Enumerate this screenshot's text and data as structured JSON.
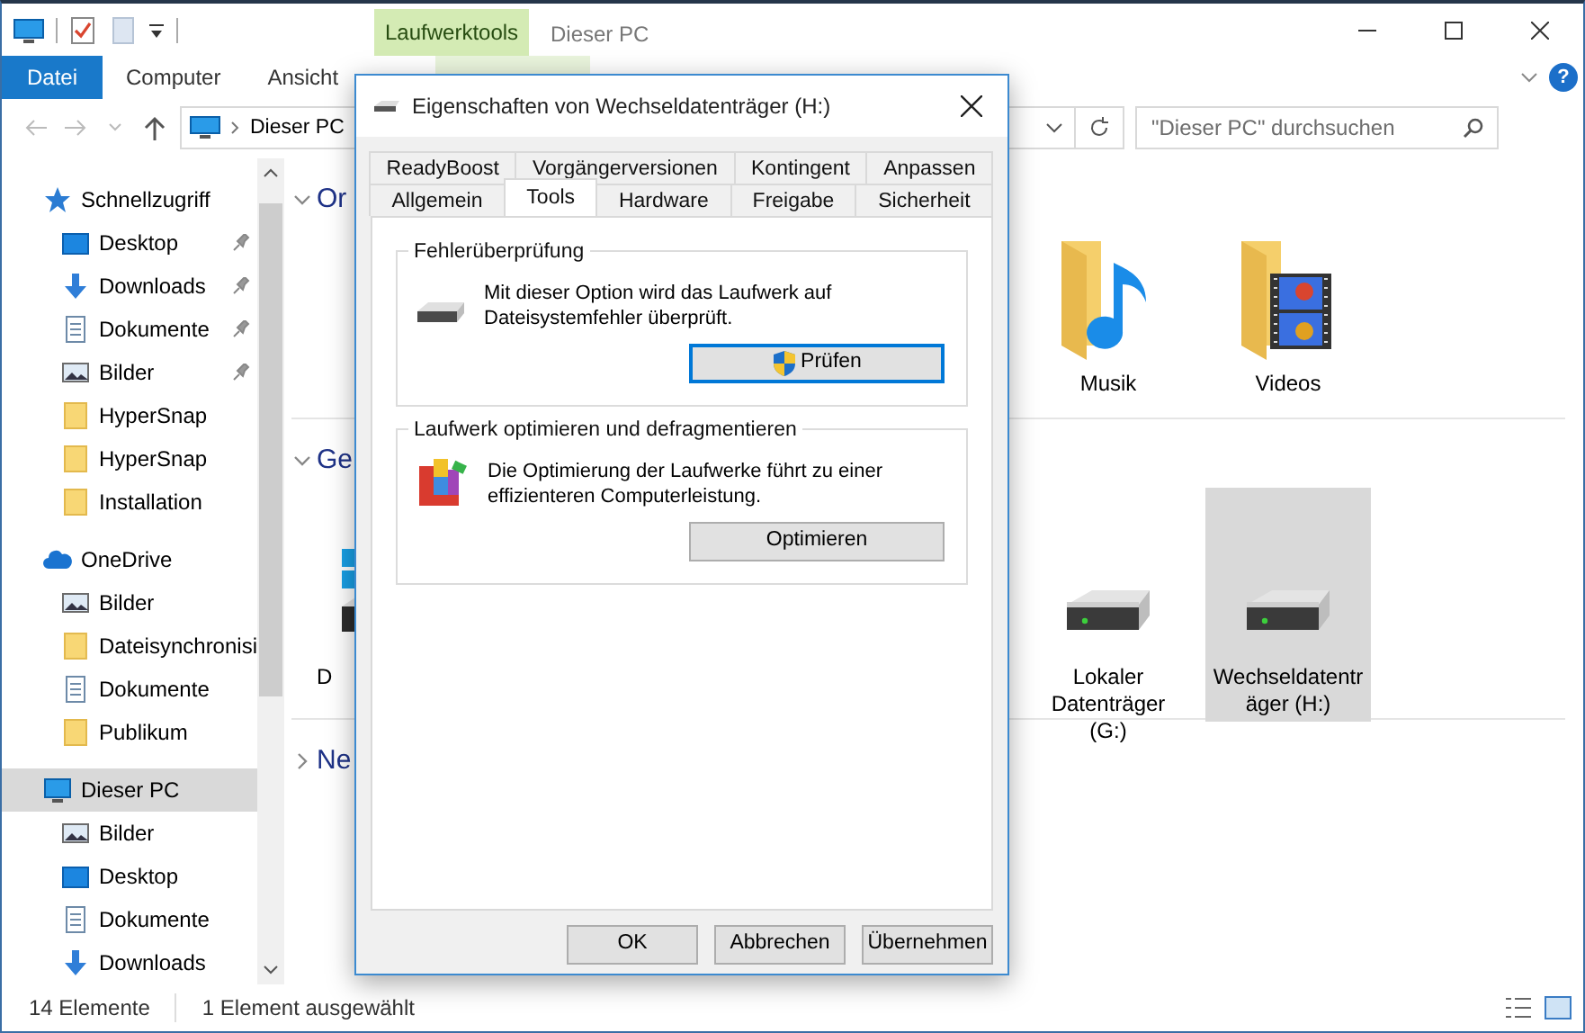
{
  "window": {
    "title": "Dieser PC",
    "context_tab": "Laufwerktools"
  },
  "ribbon_tabs": [
    {
      "label": "Datei",
      "kind": "file"
    },
    {
      "label": "Computer",
      "kind": "tab"
    },
    {
      "label": "Ansicht",
      "kind": "tab"
    }
  ],
  "address_bar": {
    "path": "Dieser PC"
  },
  "search": {
    "placeholder": "\"Dieser PC\" durchsuchen"
  },
  "help_button": {
    "label": "?"
  },
  "sidebar": {
    "items": [
      {
        "label": "Schnellzugriff",
        "kind": "star",
        "selected": false,
        "children": [
          {
            "label": "Desktop",
            "kind": "desktop",
            "pinned": true,
            "selected": false
          },
          {
            "label": "Downloads",
            "kind": "download",
            "pinned": true,
            "selected": false
          },
          {
            "label": "Dokumente",
            "kind": "document",
            "pinned": true,
            "selected": false
          },
          {
            "label": "Bilder",
            "kind": "picture",
            "pinned": true,
            "selected": false
          },
          {
            "label": "HyperSnap",
            "kind": "folder",
            "pinned": false,
            "selected": false
          },
          {
            "label": "HyperSnap",
            "kind": "folder",
            "pinned": false,
            "selected": false
          },
          {
            "label": "Installation",
            "kind": "folder",
            "pinned": false,
            "selected": false
          }
        ]
      },
      {
        "label": "OneDrive",
        "kind": "cloud",
        "selected": false,
        "children": [
          {
            "label": "Bilder",
            "kind": "picture",
            "selected": false
          },
          {
            "label": "Dateisynchronisi",
            "kind": "folder",
            "selected": false
          },
          {
            "label": "Dokumente",
            "kind": "document",
            "selected": false
          },
          {
            "label": "Publikum",
            "kind": "folder",
            "selected": false
          }
        ]
      },
      {
        "label": "Dieser PC",
        "kind": "computer",
        "selected": true,
        "children": [
          {
            "label": "Bilder",
            "kind": "picture",
            "selected": false
          },
          {
            "label": "Desktop",
            "kind": "desktop",
            "selected": false
          },
          {
            "label": "Dokumente",
            "kind": "document",
            "selected": false
          },
          {
            "label": "Downloads",
            "kind": "download",
            "selected": false
          }
        ]
      }
    ]
  },
  "content": {
    "groups": [
      {
        "title": "Or",
        "expanded": true,
        "items": [
          {
            "label": "Musik",
            "kind": "music-folder",
            "selected": false
          },
          {
            "label": "Videos",
            "kind": "video-folder",
            "selected": false
          }
        ]
      },
      {
        "title": "Ge",
        "expanded": true,
        "items": [
          {
            "label": "D",
            "kind": "system-drive",
            "selected": false
          },
          {
            "label": "Lokaler Datenträger (G:)",
            "kind": "drive",
            "selected": false
          },
          {
            "label": "Wechseldatenträger (H:)",
            "kind": "drive",
            "selected": true
          }
        ]
      },
      {
        "title": "Ne",
        "expanded": false
      }
    ]
  },
  "status_bar": {
    "count": "14 Elemente",
    "selection": "1 Element ausgewählt"
  },
  "dialog": {
    "title": "Eigenschaften von Wechseldatenträger (H:)",
    "tab_rows": [
      [
        {
          "label": "ReadyBoost",
          "selected": false
        },
        {
          "label": "Vorgängerversionen",
          "selected": false
        },
        {
          "label": "Kontingent",
          "selected": false
        },
        {
          "label": "Anpassen",
          "selected": false
        }
      ],
      [
        {
          "label": "Allgemein",
          "selected": false
        },
        {
          "label": "Tools",
          "selected": true
        },
        {
          "label": "Hardware",
          "selected": false
        },
        {
          "label": "Freigabe",
          "selected": false
        },
        {
          "label": "Sicherheit",
          "selected": false
        }
      ]
    ],
    "sections": [
      {
        "title": "Fehlerüberprüfung",
        "kind": "check",
        "text": "Mit dieser Option wird das Laufwerk auf Dateisystemfehler überprüft.",
        "button": {
          "label": "Prüfen",
          "elevated": true,
          "default": true
        }
      },
      {
        "title": "Laufwerk optimieren und defragmentieren",
        "kind": "defrag",
        "text": "Die Optimierung der Laufwerke führt zu einer effizienteren Computerleistung.",
        "button": {
          "label": "Optimieren",
          "elevated": false,
          "default": false
        }
      }
    ],
    "buttons": [
      {
        "label": "OK"
      },
      {
        "label": "Abbrechen"
      },
      {
        "label": "Übernehmen"
      }
    ]
  }
}
